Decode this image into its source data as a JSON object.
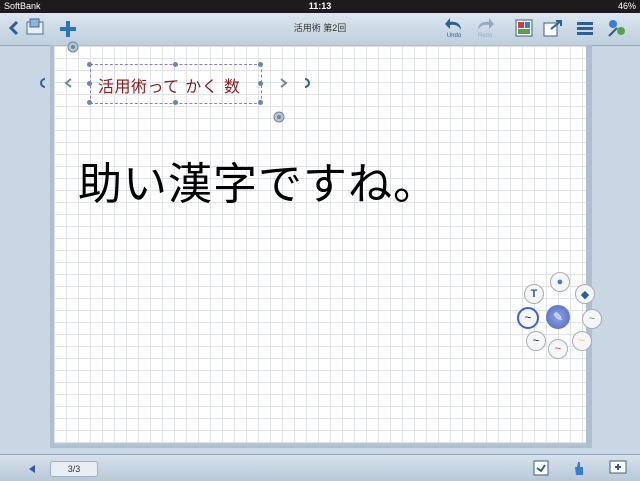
{
  "status": {
    "carrier": "SoftBank",
    "time": "11:13",
    "battery": "46%"
  },
  "header": {
    "title": "活用術 第2回",
    "undo_label": "Undo",
    "redo_label": "Redo"
  },
  "note": {
    "selected_text": "活用術って かく 数",
    "handwriting": "助い漢字ですね。"
  },
  "palette": {
    "text_tool": "T"
  },
  "footer": {
    "page_indicator": "3/3"
  },
  "icons": [
    "back-icon",
    "notebook-icon",
    "add-icon",
    "undo-icon",
    "redo-icon",
    "layout-icon",
    "export-icon",
    "menu-icon",
    "share-icon",
    "pen-icon",
    "eraser-icon",
    "insert-icon"
  ]
}
